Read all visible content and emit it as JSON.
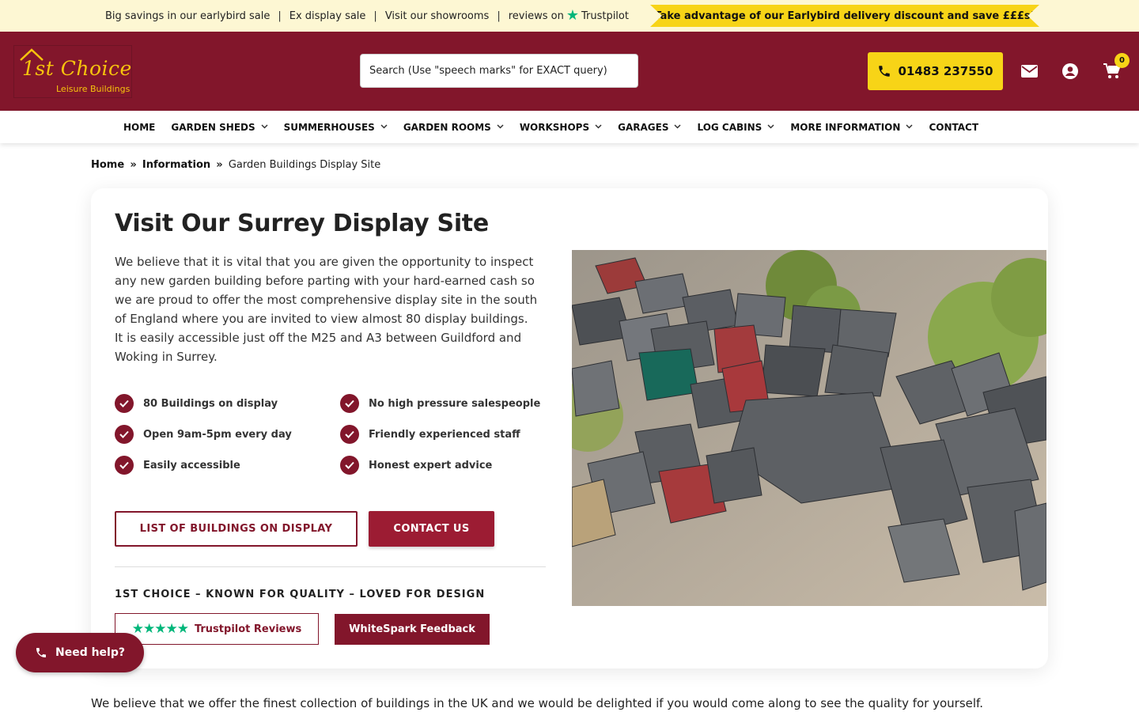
{
  "topbar": {
    "links": [
      "Big savings in our earlybird sale",
      "Ex display sale",
      "Visit our showrooms"
    ],
    "reviews_prefix": "reviews on",
    "trustpilot": "Trustpilot",
    "promo": "Take advantage of our Earlybird delivery discount and save £££s!"
  },
  "header": {
    "logo_main": "1st Choice",
    "logo_sub": "Leisure Buildings",
    "search_placeholder": "Search (Use \"speech marks\" for EXACT query)",
    "phone": "01483 237550",
    "cart_count": "0"
  },
  "nav": {
    "items": [
      {
        "label": "HOME",
        "dropdown": false
      },
      {
        "label": "GARDEN SHEDS",
        "dropdown": true
      },
      {
        "label": "SUMMERHOUSES",
        "dropdown": true
      },
      {
        "label": "GARDEN ROOMS",
        "dropdown": true
      },
      {
        "label": "WORKSHOPS",
        "dropdown": true
      },
      {
        "label": "GARAGES",
        "dropdown": true
      },
      {
        "label": "LOG CABINS",
        "dropdown": true
      },
      {
        "label": "MORE INFORMATION",
        "dropdown": true
      },
      {
        "label": "CONTACT",
        "dropdown": false
      }
    ]
  },
  "breadcrumb": {
    "home": "Home",
    "info": "Information",
    "sep": "»",
    "current": "Garden Buildings Display Site"
  },
  "main": {
    "title": "Visit Our Surrey Display Site",
    "intro": "We believe that it is vital that you are given the opportunity to inspect any new garden building before parting with your hard-earned cash so we are proud to offer the most comprehensive display site in the south of England where you are invited to view almost 80 display buildings. It is easily accessible just off the M25 and A3 between Guildford and Woking in Surrey.",
    "features": [
      "80 Buildings on display",
      "No high pressure salespeople",
      "Open 9am-5pm every day",
      "Friendly experienced staff",
      "Easily accessible",
      "Honest expert advice"
    ],
    "btn_list": "LIST OF BUILDINGS ON DISPLAY",
    "btn_contact": "CONTACT US",
    "tagline": "1ST CHOICE – KNOWN FOR QUALITY – LOVED FOR DESIGN",
    "trustpilot_btn": "Trustpilot Reviews",
    "trustpilot_stars": "★★★★★",
    "whitespark_btn": "WhiteSpark Feedback"
  },
  "need_help": "Need help?",
  "bottom_text": "We believe that we offer the finest collection of buildings in the UK and we would be delighted if you would come along to see the quality for yourself.",
  "colors": {
    "brand": "#82162b",
    "accent": "#f7d417",
    "topbar_bg": "#fdf7d3",
    "trustpilot_green": "#00b67a"
  },
  "icons": [
    "trustpilot-star-icon",
    "phone-icon",
    "mail-icon",
    "account-icon",
    "cart-icon",
    "chevron-down-icon",
    "check-icon"
  ]
}
